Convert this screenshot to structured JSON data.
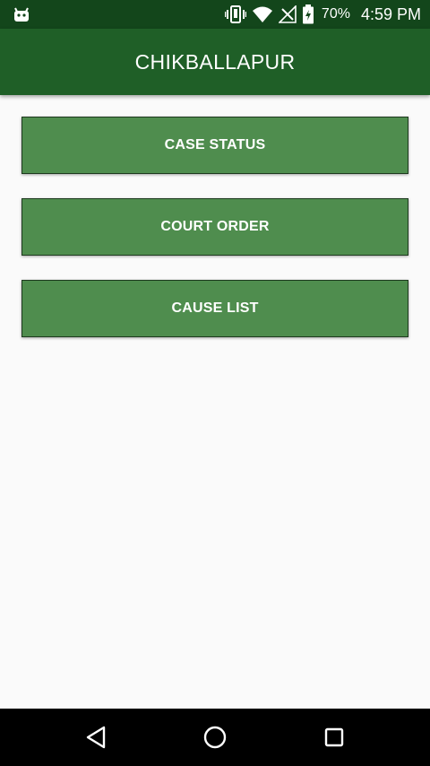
{
  "status_bar": {
    "battery": "70%",
    "time": "4:59 PM",
    "icons": [
      "android-robot-icon",
      "vibrate-icon",
      "wifi-icon",
      "no-signal-icon",
      "battery-charging-icon"
    ]
  },
  "app_bar": {
    "title": "CHIKBALLAPUR"
  },
  "menu": {
    "items": [
      {
        "label": "CASE STATUS"
      },
      {
        "label": "COURT ORDER"
      },
      {
        "label": "CAUSE LIST"
      }
    ]
  },
  "nav_bar": {
    "icons": [
      "back-icon",
      "home-icon",
      "recents-icon"
    ]
  },
  "colors": {
    "status_bar": "#13461b",
    "app_bar": "#1f5f27",
    "button": "#4f8d4e",
    "background": "#fafafa",
    "nav_bar": "#000000"
  }
}
